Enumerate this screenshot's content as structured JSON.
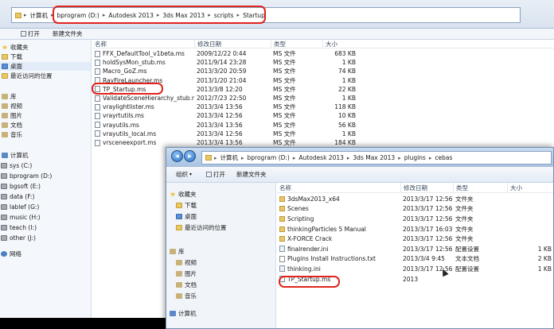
{
  "back_window": {
    "breadcrumb": [
      "计算机",
      "bprogram (D:)",
      "Autodesk 2013",
      "3ds Max 2013",
      "scripts",
      "Startup"
    ],
    "toolbar": {
      "open_label": "打开",
      "new_folder_label": "新建文件夹"
    },
    "sidebar": {
      "favorites": "收藏夹",
      "downloads": "下载",
      "desktop": "桌面",
      "recent": "最近访问的位置",
      "libraries": "库",
      "videos": "视频",
      "pictures": "图片",
      "documents": "文档",
      "music": "音乐",
      "computer": "计算机",
      "drives": [
        "sys (C:)",
        "bprogram (D:)",
        "bgsoft (E:)",
        "data (F:)",
        "lablef (G:)",
        "music (H:)",
        "teach (I:)",
        "other (J:)"
      ],
      "network": "网络"
    },
    "columns": {
      "name": "名称",
      "date": "修改日期",
      "type": "类型",
      "size": "大小"
    },
    "files": [
      {
        "name": "FFX_DefaultTool_v1beta.ms",
        "date": "2009/12/22 0:44",
        "type": "MS 文件",
        "size": "683 KB"
      },
      {
        "name": "holdSysMon_stub.ms",
        "date": "2011/9/14 23:28",
        "type": "MS 文件",
        "size": "1 KB"
      },
      {
        "name": "Macro_GoZ.ms",
        "date": "2013/3/20 20:59",
        "type": "MS 文件",
        "size": "74 KB"
      },
      {
        "name": "RayFireLauncher.ms",
        "date": "2013/1/20 21:04",
        "type": "MS 文件",
        "size": "1 KB"
      },
      {
        "name": "TP_Startup.ms",
        "date": "2013/3/8 12:20",
        "type": "MS 文件",
        "size": "22 KB"
      },
      {
        "name": "ValidateSceneHierarchy_stub.ms",
        "date": "2012/7/23 22:50",
        "type": "MS 文件",
        "size": "1 KB"
      },
      {
        "name": "vraylightlister.ms",
        "date": "2013/3/4 13:56",
        "type": "MS 文件",
        "size": "118 KB"
      },
      {
        "name": "vrayrtutils.ms",
        "date": "2013/3/4 12:56",
        "type": "MS 文件",
        "size": "10 KB"
      },
      {
        "name": "vrayutils.ms",
        "date": "2013/3/4 13:56",
        "type": "MS 文件",
        "size": "56 KB"
      },
      {
        "name": "vrayutils_local.ms",
        "date": "2013/3/4 12:56",
        "type": "MS 文件",
        "size": "1 KB"
      },
      {
        "name": "vrsceneexport.ms",
        "date": "2013/3/4 13:56",
        "type": "MS 文件",
        "size": "184 KB"
      }
    ]
  },
  "front_window": {
    "breadcrumb": [
      "计算机",
      "bprogram (D:)",
      "Autodesk 2013",
      "3ds Max 2013",
      "plugins",
      "cebas"
    ],
    "toolbar": {
      "organize_label": "组织",
      "open_label": "打开",
      "new_folder_label": "新建文件夹"
    },
    "sidebar": {
      "favorites": "收藏夹",
      "downloads": "下载",
      "desktop": "桌面",
      "recent": "最近访问的位置",
      "libraries": "库",
      "videos": "视频",
      "pictures": "图片",
      "documents": "文档",
      "music": "音乐",
      "computer": "计算机"
    },
    "columns": {
      "name": "名称",
      "date": "修改日期",
      "type": "类型",
      "size": "大小"
    },
    "files": [
      {
        "name": "3dsMax2013_x64",
        "date": "2013/3/17 12:56",
        "type": "文件夹",
        "size": "",
        "kind": "folder"
      },
      {
        "name": "Scenes",
        "date": "2013/3/17 12:56",
        "type": "文件夹",
        "size": "",
        "kind": "folder"
      },
      {
        "name": "Scripting",
        "date": "2013/3/17 12:56",
        "type": "文件夹",
        "size": "",
        "kind": "folder"
      },
      {
        "name": "thinkingParticles 5 Manual",
        "date": "2013/3/17 16:03",
        "type": "文件夹",
        "size": "",
        "kind": "folder"
      },
      {
        "name": "X-FORCE Crack",
        "date": "2013/3/17 12:56",
        "type": "文件夹",
        "size": "",
        "kind": "folder"
      },
      {
        "name": "finalrender.ini",
        "date": "2013/3/17 12:56",
        "type": "配置设置",
        "size": "1 KB",
        "kind": "ini"
      },
      {
        "name": "Plugins Install Instructions.txt",
        "date": "2013/3/4 9:45",
        "type": "文本文档",
        "size": "2 KB",
        "kind": "txt"
      },
      {
        "name": "thinking.ini",
        "date": "2013/3/17 12:56",
        "type": "配置设置",
        "size": "1 KB",
        "kind": "ini"
      },
      {
        "name": "TP_Startup.ms",
        "date": "2013",
        "type": "",
        "size": "",
        "kind": "ms"
      }
    ]
  }
}
